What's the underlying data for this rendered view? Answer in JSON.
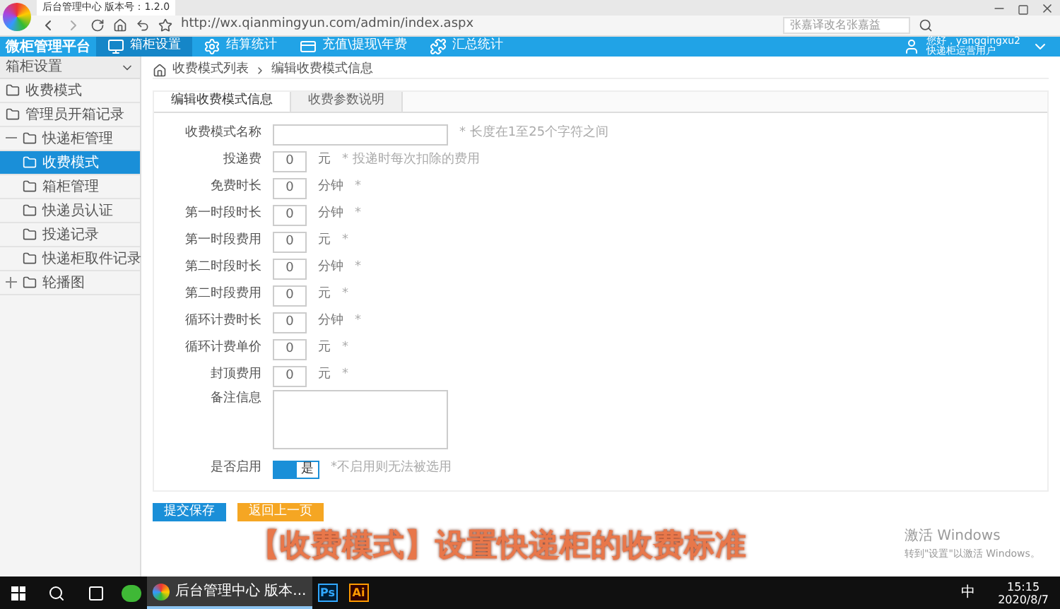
{
  "browser": {
    "tab_title": "后台管理中心 版本号：1.2.0",
    "url": "http://wx.qianmingyun.com/admin/index.aspx",
    "search_placeholder": "张嘉译改名张嘉益"
  },
  "header": {
    "logo": "微柜管理平台",
    "nav": [
      {
        "label": "箱柜设置",
        "selected": true
      },
      {
        "label": "结算统计",
        "selected": false
      },
      {
        "label": "充值\\提现\\年费",
        "selected": false
      },
      {
        "label": "汇总统计",
        "selected": false
      }
    ],
    "user": {
      "greeting": "您好，yangqingxu2",
      "role": "快递柜运营用户"
    }
  },
  "sidebar": {
    "section": "箱柜设置",
    "items": [
      {
        "label": "收费模式",
        "selected": false
      },
      {
        "label": "管理员开箱记录",
        "selected": false
      },
      {
        "label": "快递柜管理",
        "selected": false,
        "expanded": true,
        "children": [
          {
            "label": "收费模式",
            "selected": true
          },
          {
            "label": "箱柜管理",
            "selected": false
          },
          {
            "label": "快递员认证",
            "selected": false
          },
          {
            "label": "投递记录",
            "selected": false
          },
          {
            "label": "快递柜取件记录",
            "selected": false
          }
        ]
      },
      {
        "label": "轮播图",
        "selected": false,
        "expanded": false
      }
    ]
  },
  "breadcrumb": [
    "收费模式列表",
    "编辑收费模式信息"
  ],
  "tabs": [
    {
      "label": "编辑收费模式信息",
      "selected": true
    },
    {
      "label": "收费参数说明",
      "selected": false
    }
  ],
  "form": [
    {
      "kind": "text",
      "label": "收费模式名称",
      "hint": "* 长度在1至25个字符之间"
    },
    {
      "kind": "number",
      "label": "投递费",
      "value": "0",
      "unit": "元",
      "hint": "* 投递时每次扣除的费用"
    },
    {
      "kind": "number",
      "label": "免费时长",
      "value": "0",
      "unit": "分钟",
      "hint": "*"
    },
    {
      "kind": "number",
      "label": "第一时段时长",
      "value": "0",
      "unit": "分钟",
      "hint": "*"
    },
    {
      "kind": "number",
      "label": "第一时段费用",
      "value": "0",
      "unit": "元",
      "hint": "*"
    },
    {
      "kind": "number",
      "label": "第二时段时长",
      "value": "0",
      "unit": "分钟",
      "hint": "*"
    },
    {
      "kind": "number",
      "label": "第二时段费用",
      "value": "0",
      "unit": "元",
      "hint": "*"
    },
    {
      "kind": "number",
      "label": "循环计费时长",
      "value": "0",
      "unit": "分钟",
      "hint": "*"
    },
    {
      "kind": "number",
      "label": "循环计费单价",
      "value": "0",
      "unit": "元",
      "hint": "*"
    },
    {
      "kind": "number",
      "label": "封顶费用",
      "value": "0",
      "unit": "元",
      "hint": "*"
    },
    {
      "kind": "textarea",
      "label": "备注信息"
    },
    {
      "kind": "toggle",
      "label": "是否启用",
      "value": "是",
      "on": true,
      "hint": "*不启用则无法被选用"
    }
  ],
  "buttons": [
    {
      "label": "提交保存",
      "kind": "primary"
    },
    {
      "label": "返回上一页",
      "kind": "secondary"
    }
  ],
  "caption": "【收费模式】设置快递柜的收费标准",
  "activation": {
    "title": "激活 Windows",
    "subtitle": "转到\"设置\"以激活 Windows。"
  },
  "taskbar": {
    "apps": [
      {
        "kind": "wechat"
      },
      {
        "kind": "browser",
        "label": "后台管理中心 版本...",
        "selected": true
      },
      {
        "kind": "ps",
        "label": "Ps"
      },
      {
        "kind": "ai",
        "label": "Ai"
      }
    ],
    "ime": "中",
    "time": "15:15",
    "date": "2020/8/7"
  }
}
